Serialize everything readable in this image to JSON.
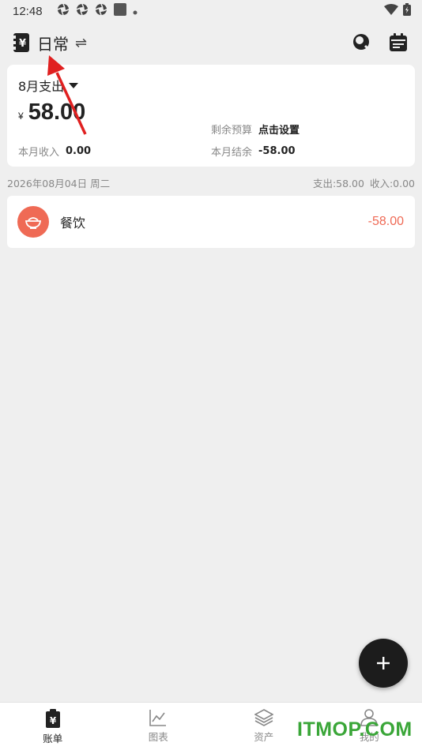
{
  "status_bar": {
    "time": "12:48"
  },
  "header": {
    "book_name": "日常"
  },
  "summary": {
    "month_label": "8月支出",
    "currency": "¥",
    "expense": "58.00",
    "budget_label": "剩余预算",
    "budget_value": "点击设置",
    "income_label": "本月收入",
    "income_value": "0.00",
    "balance_label": "本月结余",
    "balance_value": "-58.00"
  },
  "day_group": {
    "date": "2026年08月04日 周二",
    "expense": "支出:58.00",
    "income": "收入:0.00"
  },
  "records": [
    {
      "category": "餐饮",
      "amount": "-58.00"
    }
  ],
  "bottom_nav": [
    {
      "label": "账单"
    },
    {
      "label": "图表"
    },
    {
      "label": "资产"
    },
    {
      "label": "我的"
    }
  ],
  "watermark": "ITMOP.COM",
  "colors": {
    "accent_red": "#ef6a55",
    "fab": "#1c1c1c",
    "watermark": "#3aa638"
  }
}
